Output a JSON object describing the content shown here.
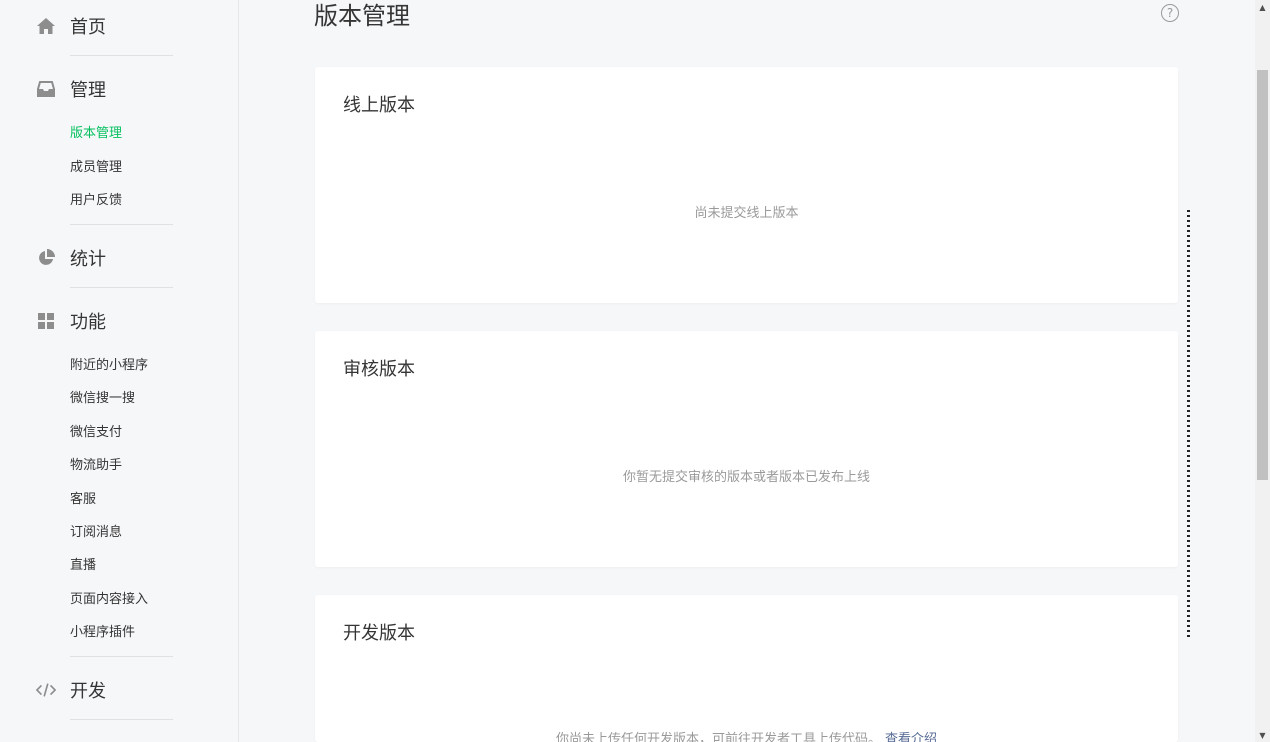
{
  "sidebar": {
    "home": {
      "label": "首页",
      "icon": "home-icon"
    },
    "manage": {
      "label": "管理",
      "icon": "inbox-icon",
      "items": [
        {
          "label": "版本管理",
          "active": true
        },
        {
          "label": "成员管理",
          "active": false
        },
        {
          "label": "用户反馈",
          "active": false
        }
      ]
    },
    "stats": {
      "label": "统计",
      "icon": "pie-chart-icon"
    },
    "features": {
      "label": "功能",
      "icon": "grid-icon",
      "items": [
        {
          "label": "附近的小程序"
        },
        {
          "label": "微信搜一搜"
        },
        {
          "label": "微信支付"
        },
        {
          "label": "物流助手"
        },
        {
          "label": "客服"
        },
        {
          "label": "订阅消息"
        },
        {
          "label": "直播"
        },
        {
          "label": "页面内容接入"
        },
        {
          "label": "小程序插件"
        }
      ]
    },
    "dev": {
      "label": "开发",
      "icon": "code-icon"
    }
  },
  "main": {
    "title": "版本管理",
    "help_symbol": "?",
    "cards": [
      {
        "title": "线上版本",
        "empty_text": "尚未提交线上版本"
      },
      {
        "title": "审核版本",
        "empty_text": "你暂无提交审核的版本或者版本已发布上线"
      },
      {
        "title": "开发版本",
        "empty_text": "你尚未上传任何开发版本，可前往开发者工具上传代码。",
        "link": "查看介绍"
      }
    ]
  },
  "colors": {
    "accent": "#07c160",
    "link": "#576b95",
    "muted": "#9a9a9a"
  }
}
